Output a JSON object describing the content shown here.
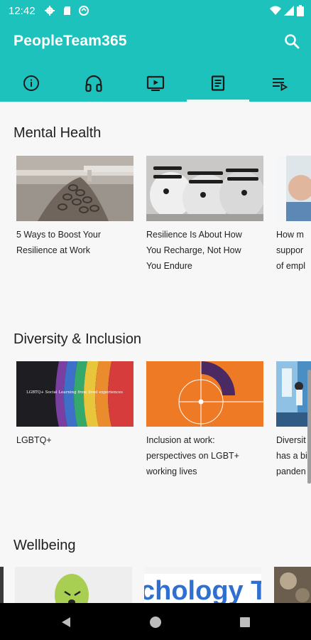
{
  "status_bar": {
    "time": "12:42",
    "icons": [
      "settings-gear-icon",
      "sd-card-icon",
      "data-saver-icon",
      "wifi-icon",
      "cellular-signal-icon",
      "battery-icon"
    ]
  },
  "app": {
    "title": "PeopleTeam365",
    "accent_color": "#1ec2bd"
  },
  "tabs": [
    {
      "icon": "info-icon",
      "selected": false
    },
    {
      "icon": "headphones-icon",
      "selected": false
    },
    {
      "icon": "video-player-icon",
      "selected": false
    },
    {
      "icon": "article-icon",
      "selected": true
    },
    {
      "icon": "playlist-icon",
      "selected": false
    }
  ],
  "sections": [
    {
      "title": "Mental Health",
      "cards": [
        {
          "text": "5 Ways to Boost Your\nResilience at Work"
        },
        {
          "text": "Resilience Is About How\nYou Recharge, Not How\nYou Endure"
        },
        {
          "text": "How m\nsuppor\nof empl"
        }
      ]
    },
    {
      "title": "Diversity & Inclusion",
      "cards": [
        {
          "text": "LGBTQ+",
          "image_caption": "LGBTQ+ Social Learning from lived experiences"
        },
        {
          "text": "Inclusion at work:\nperspectives on LGBT+\nworking lives"
        },
        {
          "text": "Diversit\nhas a bi\npanden"
        }
      ]
    },
    {
      "title": "Wellbeing",
      "cards": [
        {
          "text": ""
        },
        {
          "text": "",
          "image_caption": "chology T"
        },
        {
          "text": ""
        }
      ]
    }
  ],
  "nav": {
    "icons": [
      "back-triangle-icon",
      "home-circle-icon",
      "recents-square-icon"
    ]
  }
}
